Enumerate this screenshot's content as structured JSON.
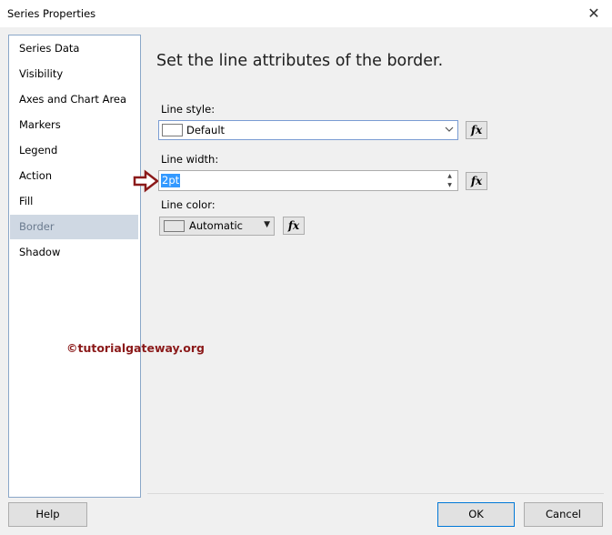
{
  "window": {
    "title": "Series Properties",
    "close_glyph": "✕"
  },
  "nav": {
    "items": [
      {
        "label": "Series Data",
        "selected": false
      },
      {
        "label": "Visibility",
        "selected": false
      },
      {
        "label": "Axes and Chart Area",
        "selected": false
      },
      {
        "label": "Markers",
        "selected": false
      },
      {
        "label": "Legend",
        "selected": false
      },
      {
        "label": "Action",
        "selected": false
      },
      {
        "label": "Fill",
        "selected": false
      },
      {
        "label": "Border",
        "selected": true
      },
      {
        "label": "Shadow",
        "selected": false
      }
    ]
  },
  "content": {
    "heading": "Set the line attributes of the border.",
    "line_style": {
      "label": "Line style:",
      "value": "Default"
    },
    "line_width": {
      "label": "Line width:",
      "value": "2pt"
    },
    "line_color": {
      "label": "Line color:",
      "value": "Automatic"
    },
    "fx_label": "fx"
  },
  "watermark": "©tutorialgateway.org",
  "buttons": {
    "help": "Help",
    "ok": "OK",
    "cancel": "Cancel"
  },
  "colors": {
    "accent": "#0078d7",
    "selected_bg": "#cfd8e3",
    "watermark": "#8b1a1a",
    "arrow": "#8b1a1a"
  },
  "icons": {
    "close": "close-icon",
    "dropdown": "chevron-down-icon",
    "arrow": "right-arrow-icon"
  }
}
